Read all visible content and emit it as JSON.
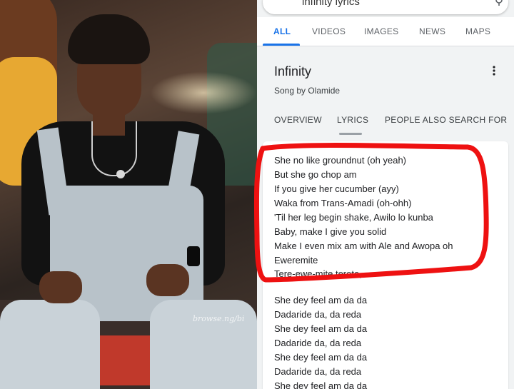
{
  "photo": {
    "watermark": "browse.ng/bi"
  },
  "search": {
    "query": "infinity lyrics"
  },
  "tabs": [
    {
      "label": "ALL",
      "active": true
    },
    {
      "label": "VIDEOS",
      "active": false
    },
    {
      "label": "IMAGES",
      "active": false
    },
    {
      "label": "NEWS",
      "active": false
    },
    {
      "label": "MAPS",
      "active": false
    }
  ],
  "knowledge_panel": {
    "title": "Infinity",
    "subtitle": "Song by Olamide",
    "tabs": [
      {
        "label": "OVERVIEW",
        "active": false
      },
      {
        "label": "LYRICS",
        "active": true
      },
      {
        "label": "PEOPLE ALSO SEARCH FOR",
        "active": false
      }
    ]
  },
  "lyrics": {
    "block1": [
      "She no like groundnut (oh yeah)",
      "But she go chop am",
      "If you give her cucumber (ayy)",
      "Waka from Trans-Amadi (oh-ohh)",
      "'Til her leg begin shake, Awilo lo kunba",
      "Baby, make I give you solid",
      "Make I even mix am with Ale and Awopa oh",
      "Eweremite",
      "Tere-ewe-mite terete,"
    ],
    "block2": [
      "She dey feel am da da",
      "Dadaride da, da reda",
      "She dey feel am da da",
      "Dadaride da, da reda",
      "She dey feel am da da",
      "Dadaride da, da reda",
      "She dey feel am da da"
    ]
  },
  "colors": {
    "accent": "#1a73e8",
    "highlight": "#ee1111"
  }
}
